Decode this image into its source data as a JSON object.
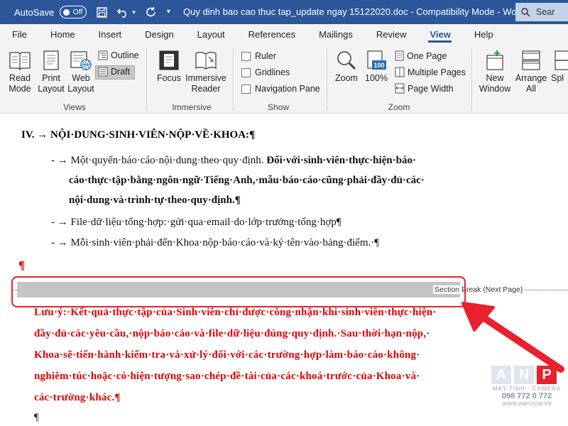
{
  "titlebar": {
    "autosave_label": "AutoSave",
    "autosave_state": "Off",
    "doc_title": "Quy dinh bao cao thuc tap_update ngay 15122020.doc  -  Compatibility Mode  -  Word",
    "search_label": "Sear"
  },
  "tabs": [
    "File",
    "Home",
    "Insert",
    "Design",
    "Layout",
    "References",
    "Mailings",
    "Review",
    "View",
    "Help"
  ],
  "active_tab": "View",
  "ribbon": {
    "views": {
      "label": "Views",
      "read_mode": [
        "Read",
        "Mode"
      ],
      "print_layout": [
        "Print",
        "Layout"
      ],
      "web_layout": [
        "Web",
        "Layout"
      ],
      "outline": "Outline",
      "draft": "Draft"
    },
    "immersive": {
      "label": "Immersive",
      "focus": "Focus",
      "immersive_reader": [
        "Immersive",
        "Reader"
      ]
    },
    "show": {
      "label": "Show",
      "ruler": "Ruler",
      "gridlines": "Gridlines",
      "navigation_pane": "Navigation Pane"
    },
    "zoom": {
      "label": "Zoom",
      "zoom": "Zoom",
      "hundred": "100%",
      "one_page": "One Page",
      "multiple_pages": "Multiple Pages",
      "page_width": "Page Width"
    },
    "window": {
      "new_window": [
        "New",
        "Window"
      ],
      "arrange_all": [
        "Arrange",
        "All"
      ],
      "split": "Spl"
    }
  },
  "document": {
    "heading": "IV. → NỘI·DUNG·SINH·VIÊN·NỘP·VỀ·KHOA:¶",
    "bullet1_normal": "- → Một·quyển·báo·cáo·nội·dung·theo·quy·định. ",
    "bullet1_bold": "Đối·với·sinh·viên·thực·hiện·báo·",
    "bullet1_line2": "cáo·thực·tập·bằng·ngôn·ngữ·Tiếng·Anh,·mẫu·báo·cáo·cũng·phải·đầy·đủ·các·",
    "bullet1_line3": "nội·dung·và·trình·tự·theo·quy·định.¶",
    "bullet2": "- → File·dữ·liệu·tổng·hợp:·gửi·qua·email·do·lớp·trưởng·tổng·hợp¶",
    "bullet3": "- → Mỗi·sinh·viên·phải·đến·Khoa·nộp·báo·cáo·và·ký·tên·vào·bảng·điểm.·¶",
    "pilcrow": "¶",
    "section_break": "Section Break (Next Page)",
    "note_line1": "Lưu·ý:·Kết·quả·thực·tập·của·Sinh·viên·chỉ·được·công·nhận·khi·sinh·viên·thực·hiện·",
    "note_line2": "đầy·đủ·các·yêu·cầu,·nộp·báo·cáo·và·file·dữ·liệu·đúng·quy·định.·Sau·thời·hạn·nộp,·",
    "note_line3": "Khoa·sẽ·tiến·hành·kiểm·tra·và·xử·lý·đối·với·các·trường·hợp·làm·báo·cáo·không·",
    "note_line4": "nghiêm·túc·hoặc·có·hiện·tượng·sao·chép·đề·tài·của·các·khoá·trước·của·Khoa·và·",
    "note_line5": "các·trường·khác.¶",
    "last_pilcrow": "¶"
  },
  "watermark": {
    "letters": [
      "A",
      "N",
      "P"
    ],
    "sub": "MÁY TÍNH - CAMERA",
    "phone": "098 772 0 772",
    "url": "WWW.ANP.COM.VN"
  },
  "colors": {
    "title_blue": "#2b579a",
    "highlight_red": "#e8212d",
    "text_red": "#e00000"
  }
}
